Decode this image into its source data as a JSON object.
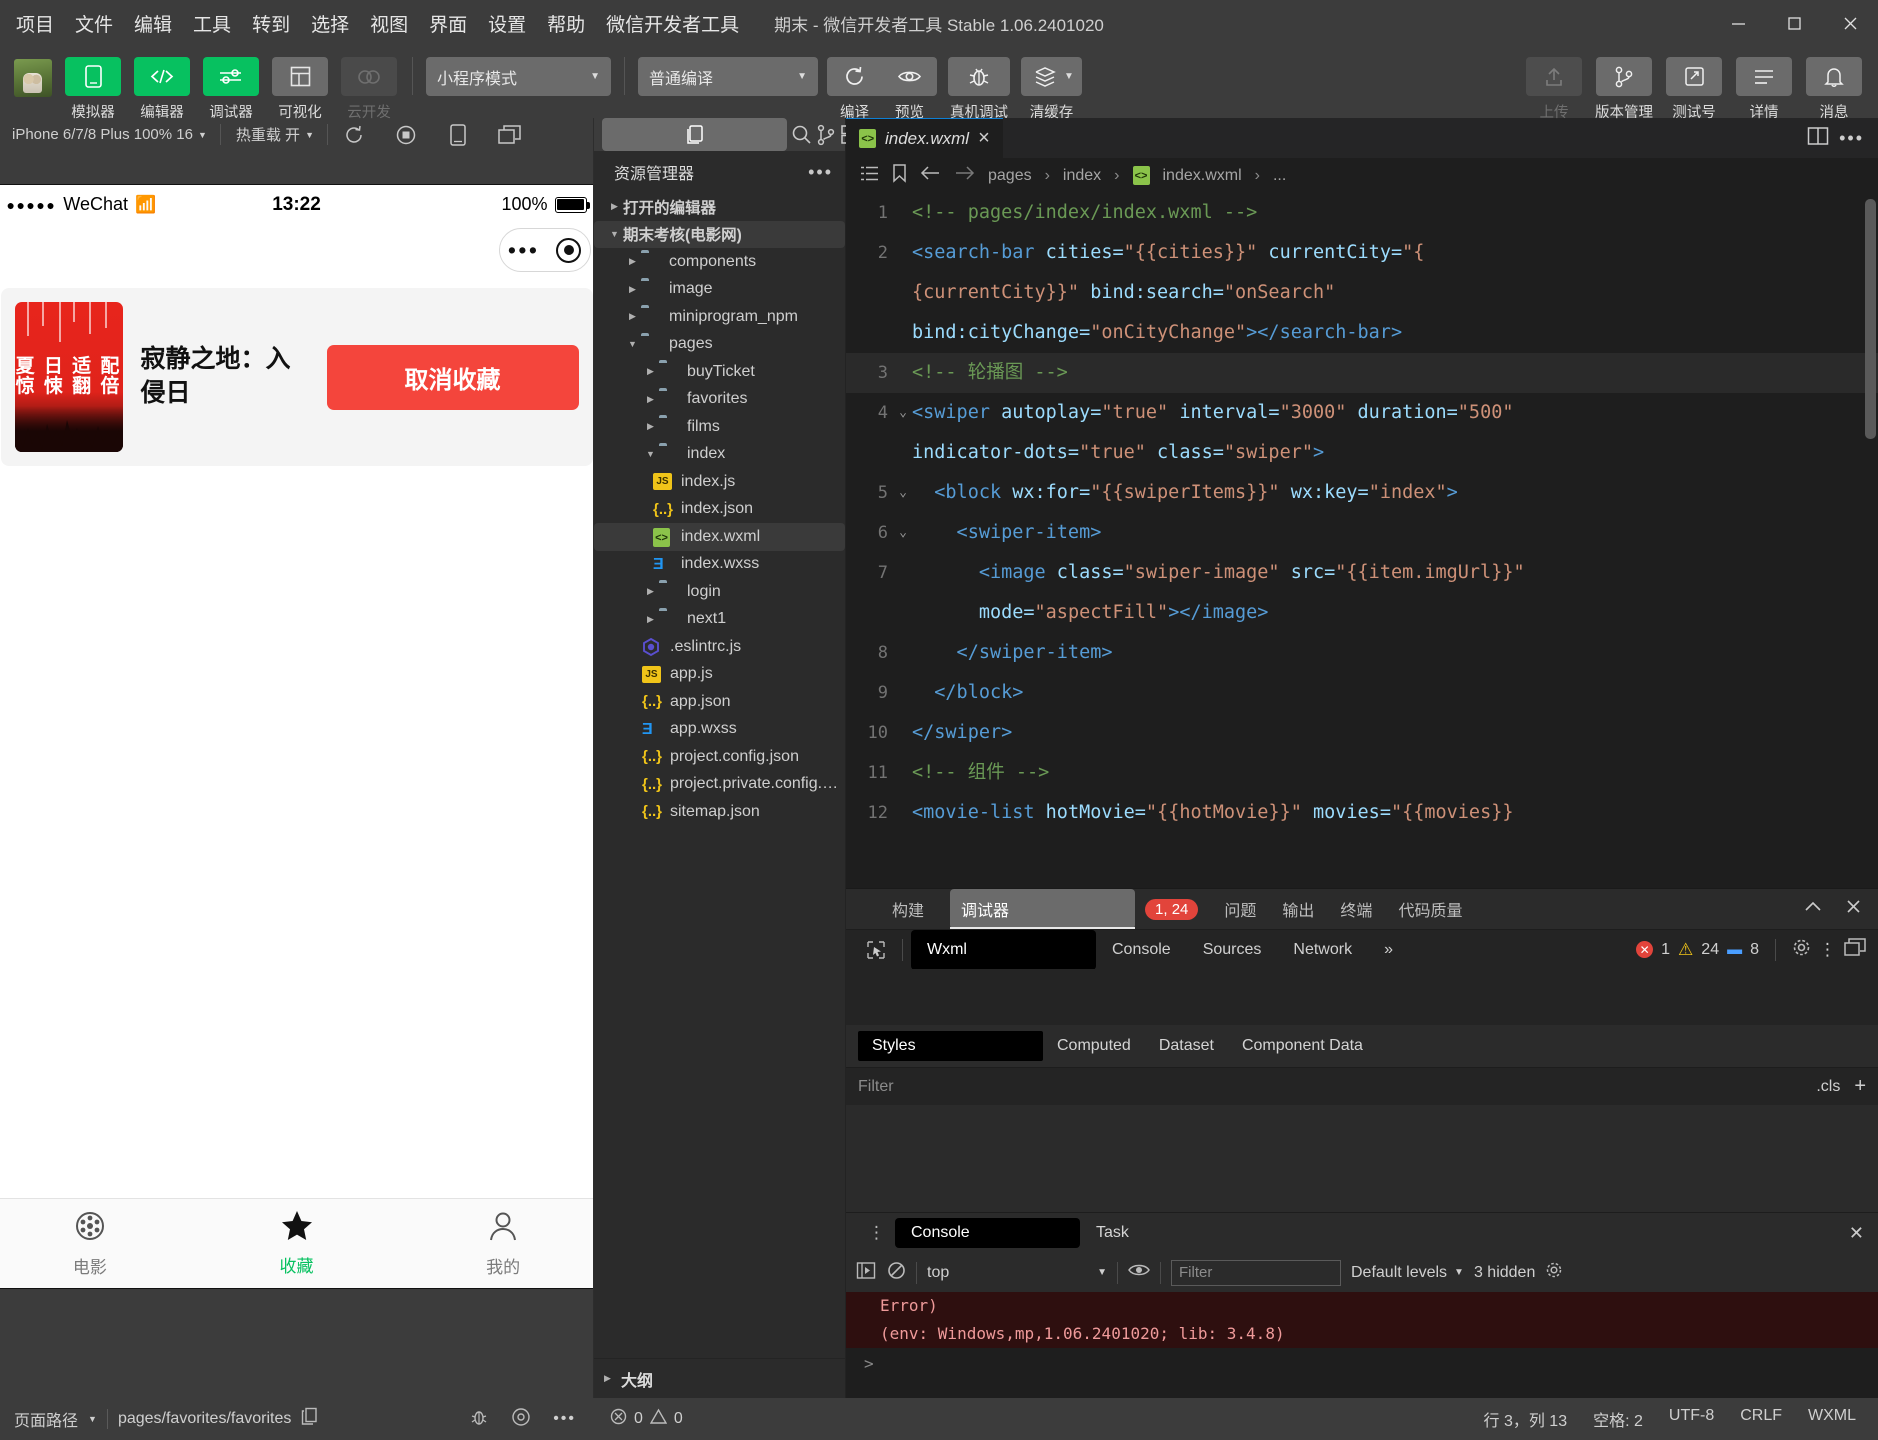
{
  "window": {
    "title": "期末 - 微信开发者工具 Stable 1.06.2401020",
    "menu": [
      "项目",
      "文件",
      "编辑",
      "工具",
      "转到",
      "选择",
      "视图",
      "界面",
      "设置",
      "帮助",
      "微信开发者工具"
    ],
    "controls": {
      "minimize": "minimize-icon",
      "maximize": "maximize-icon",
      "close": "close-icon"
    }
  },
  "toolbar": {
    "left_buttons": [
      {
        "label": "模拟器",
        "icon": "phone-icon",
        "state": "active"
      },
      {
        "label": "编辑器",
        "icon": "code-icon",
        "state": "active"
      },
      {
        "label": "调试器",
        "icon": "debug-icon",
        "state": "active"
      },
      {
        "label": "可视化",
        "icon": "layout-icon",
        "state": "inactive"
      },
      {
        "label": "云开发",
        "icon": "cloud-icon",
        "state": "disabled"
      }
    ],
    "mode_select": "小程序模式",
    "compile_select": "普通编译",
    "actions": [
      {
        "label": "编译",
        "icon": "refresh-icon"
      },
      {
        "label": "预览",
        "icon": "eye-icon"
      },
      {
        "label": "真机调试",
        "icon": "bug-icon"
      },
      {
        "label": "清缓存",
        "icon": "layers-icon"
      }
    ],
    "right_buttons": [
      {
        "label": "上传",
        "icon": "upload-icon",
        "state": "disabled"
      },
      {
        "label": "版本管理",
        "icon": "branch-icon",
        "state": "normal"
      },
      {
        "label": "测试号",
        "icon": "test-icon",
        "state": "normal"
      },
      {
        "label": "详情",
        "icon": "detail-icon",
        "state": "normal"
      },
      {
        "label": "消息",
        "icon": "bell-icon",
        "state": "normal"
      }
    ]
  },
  "simulator": {
    "device": "iPhone 6/7/8 Plus 100% 16",
    "hot_reload": "热重载 开",
    "toolbar_icons": [
      "rotate-icon",
      "record-icon",
      "device-icon",
      "window-icon"
    ],
    "phone": {
      "status": {
        "carrier": "WeChat",
        "dots": "●●●●●",
        "time": "13:22",
        "battery": "100%"
      },
      "capsule": {
        "more": "•••",
        "target": "target-icon"
      },
      "favorite_card": {
        "poster_text_line1": "夏 日 适 配",
        "poster_text_line2": "惊 悚 翻 倍",
        "title": "寂静之地：入侵日",
        "button": "取消收藏"
      },
      "tabbar": [
        {
          "label": "电影",
          "icon": "film-icon",
          "active": false
        },
        {
          "label": "收藏",
          "icon": "star-icon",
          "active": true
        },
        {
          "label": "我的",
          "icon": "user-icon",
          "active": false
        }
      ]
    }
  },
  "explorer": {
    "header": "资源管理器",
    "icons": [
      "files-icon",
      "search-icon",
      "source-control-icon",
      "extensions-icon",
      "save-icon",
      "debug-console-icon"
    ],
    "sections": [
      {
        "label": "打开的编辑器",
        "expanded": false
      },
      {
        "label": "期末考核(电影网)",
        "expanded": true
      }
    ],
    "tree": [
      {
        "name": "components",
        "type": "folder-component",
        "depth": 1,
        "expanded": false
      },
      {
        "name": "image",
        "type": "folder-image",
        "depth": 1,
        "expanded": false
      },
      {
        "name": "miniprogram_npm",
        "type": "folder",
        "depth": 1,
        "expanded": false
      },
      {
        "name": "pages",
        "type": "folder-pages",
        "depth": 1,
        "expanded": true
      },
      {
        "name": "buyTicket",
        "type": "folder",
        "depth": 2,
        "expanded": false
      },
      {
        "name": "favorites",
        "type": "folder",
        "depth": 2,
        "expanded": false
      },
      {
        "name": "films",
        "type": "folder",
        "depth": 2,
        "expanded": false
      },
      {
        "name": "index",
        "type": "folder",
        "depth": 2,
        "expanded": true
      },
      {
        "name": "index.js",
        "type": "js",
        "depth": 3
      },
      {
        "name": "index.json",
        "type": "json",
        "depth": 3
      },
      {
        "name": "index.wxml",
        "type": "wxml",
        "depth": 3,
        "selected": true
      },
      {
        "name": "index.wxss",
        "type": "wxss",
        "depth": 3
      },
      {
        "name": "login",
        "type": "folder",
        "depth": 2,
        "expanded": false
      },
      {
        "name": "next1",
        "type": "folder",
        "depth": 2,
        "expanded": false
      },
      {
        "name": ".eslintrc.js",
        "type": "eslint",
        "depth": 2
      },
      {
        "name": "app.js",
        "type": "js",
        "depth": 2
      },
      {
        "name": "app.json",
        "type": "json",
        "depth": 2
      },
      {
        "name": "app.wxss",
        "type": "wxss",
        "depth": 2
      },
      {
        "name": "project.config.json",
        "type": "json",
        "depth": 2
      },
      {
        "name": "project.private.config.js...",
        "type": "json",
        "depth": 2
      },
      {
        "name": "sitemap.json",
        "type": "json",
        "depth": 2
      }
    ],
    "footer": "大纲"
  },
  "editor": {
    "tab": {
      "name": "index.wxml",
      "icon": "wxml-icon",
      "close": "×"
    },
    "tab_right_icons": [
      "split-editor-icon",
      "more-icon"
    ],
    "breadcrumb": {
      "icons": [
        "outline-icon",
        "bookmark-icon",
        "back-arrow-icon",
        "forward-arrow-icon"
      ],
      "path": [
        "pages",
        "index",
        "index.wxml",
        "..."
      ]
    },
    "lines": [
      {
        "num": "1",
        "fold": "",
        "segments": [
          {
            "t": "<!-- pages/index/index.wxml -->",
            "c": "c-com"
          }
        ]
      },
      {
        "num": "2",
        "fold": "",
        "segments": [
          {
            "t": "<search-bar",
            "c": "c-tag"
          },
          {
            "t": " cities=",
            "c": "c-attr"
          },
          {
            "t": "\"{{cities}}\"",
            "c": "c-str"
          },
          {
            "t": " currentCity=",
            "c": "c-attr"
          },
          {
            "t": "\"{",
            "c": "c-str"
          }
        ]
      },
      {
        "num": "",
        "fold": "",
        "segments": [
          {
            "t": "{currentCity}}\"",
            "c": "c-str"
          },
          {
            "t": " bind:search=",
            "c": "c-attr"
          },
          {
            "t": "\"onSearch\"",
            "c": "c-str"
          }
        ]
      },
      {
        "num": "",
        "fold": "",
        "segments": [
          {
            "t": "bind:cityChange=",
            "c": "c-attr"
          },
          {
            "t": "\"onCityChange\"",
            "c": "c-str"
          },
          {
            "t": "></search-bar>",
            "c": "c-tag"
          }
        ]
      },
      {
        "num": "3",
        "fold": "",
        "hl": true,
        "segments": [
          {
            "t": "<!-- 轮播图 -->",
            "c": "c-com"
          }
        ]
      },
      {
        "num": "4",
        "fold": "v",
        "segments": [
          {
            "t": "<swiper",
            "c": "c-tag"
          },
          {
            "t": " autoplay=",
            "c": "c-attr"
          },
          {
            "t": "\"true\"",
            "c": "c-str"
          },
          {
            "t": " interval=",
            "c": "c-attr"
          },
          {
            "t": "\"3000\"",
            "c": "c-str"
          },
          {
            "t": " duration=",
            "c": "c-attr"
          },
          {
            "t": "\"500\"",
            "c": "c-str"
          }
        ]
      },
      {
        "num": "",
        "fold": "",
        "segments": [
          {
            "t": "indicator-dots=",
            "c": "c-attr"
          },
          {
            "t": "\"true\"",
            "c": "c-str"
          },
          {
            "t": " class=",
            "c": "c-attr"
          },
          {
            "t": "\"swiper\"",
            "c": "c-str"
          },
          {
            "t": ">",
            "c": "c-tag"
          }
        ]
      },
      {
        "num": "5",
        "fold": "v",
        "segments": [
          {
            "t": "  <block",
            "c": "c-tag"
          },
          {
            "t": " wx:for=",
            "c": "c-attr"
          },
          {
            "t": "\"{{swiperItems}}\"",
            "c": "c-str"
          },
          {
            "t": " wx:key=",
            "c": "c-attr"
          },
          {
            "t": "\"index\"",
            "c": "c-str"
          },
          {
            "t": ">",
            "c": "c-tag"
          }
        ]
      },
      {
        "num": "6",
        "fold": "v",
        "segments": [
          {
            "t": "    <swiper-item>",
            "c": "c-tag"
          }
        ]
      },
      {
        "num": "7",
        "fold": "",
        "segments": [
          {
            "t": "      <image",
            "c": "c-tag"
          },
          {
            "t": " class=",
            "c": "c-attr"
          },
          {
            "t": "\"swiper-image\"",
            "c": "c-str"
          },
          {
            "t": " src=",
            "c": "c-attr"
          },
          {
            "t": "\"{{item.imgUrl}}\"",
            "c": "c-str"
          }
        ]
      },
      {
        "num": "",
        "fold": "",
        "segments": [
          {
            "t": "      mode=",
            "c": "c-attr"
          },
          {
            "t": "\"aspectFill\"",
            "c": "c-str"
          },
          {
            "t": "></image>",
            "c": "c-tag"
          }
        ]
      },
      {
        "num": "8",
        "fold": "",
        "segments": [
          {
            "t": "    </swiper-item>",
            "c": "c-tag"
          }
        ]
      },
      {
        "num": "9",
        "fold": "",
        "segments": [
          {
            "t": "  </block>",
            "c": "c-tag"
          }
        ]
      },
      {
        "num": "10",
        "fold": "",
        "segments": [
          {
            "t": "</swiper>",
            "c": "c-tag"
          }
        ]
      },
      {
        "num": "11",
        "fold": "",
        "segments": [
          {
            "t": "<!-- 组件 -->",
            "c": "c-com"
          }
        ]
      },
      {
        "num": "12",
        "fold": "",
        "segments": [
          {
            "t": "<movie-list",
            "c": "c-tag"
          },
          {
            "t": " hotMovie=",
            "c": "c-attr"
          },
          {
            "t": "\"{{hotMovie}}\"",
            "c": "c-str"
          },
          {
            "t": " movies=",
            "c": "c-attr"
          },
          {
            "t": "\"{{movies}}",
            "c": "c-str"
          }
        ]
      }
    ]
  },
  "debugger": {
    "tabs": [
      {
        "label": "构建",
        "selected": false
      },
      {
        "label": "调试器",
        "selected": true,
        "badge": "1, 24"
      },
      {
        "label": "问题",
        "selected": false
      },
      {
        "label": "输出",
        "selected": false
      },
      {
        "label": "终端",
        "selected": false
      },
      {
        "label": "代码质量",
        "selected": false
      }
    ],
    "panel_controls": [
      "collapse-icon",
      "close-icon"
    ],
    "devtool_tabs": [
      {
        "label": "Wxml",
        "selected": true
      },
      {
        "label": "Console",
        "selected": false
      },
      {
        "label": "Sources",
        "selected": false
      },
      {
        "label": "Network",
        "selected": false
      },
      {
        "label": "»",
        "selected": false
      }
    ],
    "counts": {
      "errors": "1",
      "warnings": "24",
      "messages": "8"
    },
    "devtool_right_icons": [
      "settings-gear-icon",
      "kebab-menu-icon",
      "dock-icon"
    ],
    "styles_tabs": [
      {
        "label": "Styles",
        "selected": true
      },
      {
        "label": "Computed",
        "selected": false
      },
      {
        "label": "Dataset",
        "selected": false
      },
      {
        "label": "Component Data",
        "selected": false
      }
    ],
    "style_filter_placeholder": "Filter",
    "cls_label": ".cls",
    "console": {
      "tabs": [
        {
          "label": "Console",
          "selected": true
        },
        {
          "label": "Task",
          "selected": false
        }
      ],
      "context": "top",
      "filter_placeholder": "Filter",
      "levels": "Default levels",
      "hidden": "3 hidden",
      "output": [
        "Error)",
        "(env: Windows,mp,1.06.2401020; lib: 3.4.8)"
      ],
      "prompt": ">"
    }
  },
  "statusbar": {
    "page_path_label": "页面路径",
    "page_path": "pages/favorites/favorites",
    "copy_icon": "copy-icon",
    "sim_icons": [
      "bug-icon",
      "eye-icon",
      "more-icon"
    ],
    "problems": {
      "errors": "0",
      "warnings": "0"
    },
    "position": "行 3，列 13",
    "spaces": "空格: 2",
    "encoding": "UTF-8",
    "eol": "CRLF",
    "language": "WXML"
  }
}
